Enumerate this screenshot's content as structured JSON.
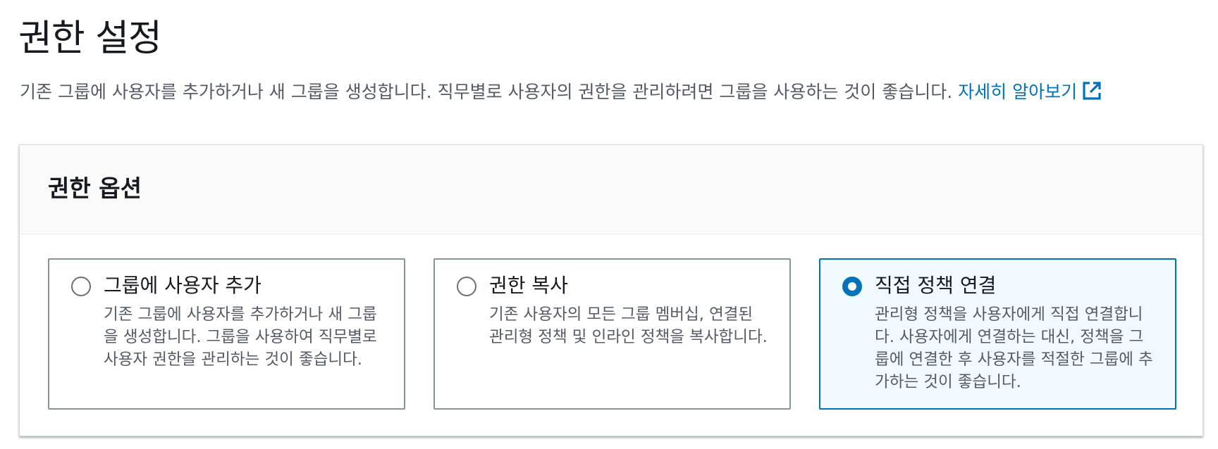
{
  "header": {
    "title": "권한 설정",
    "description": "기존 그룹에 사용자를 추가하거나 새 그룹을 생성합니다. 직무별로 사용자의 권한을 관리하려면 그룹을 사용하는 것이 좋습니다.",
    "learn_more": "자세히 알아보기",
    "learn_more_icon": "external-link-icon"
  },
  "panel": {
    "title": "권한 옵션",
    "options": [
      {
        "label": "그룹에 사용자 추가",
        "selected": false,
        "description_lines": [
          "기존 그룹에 사용자를 추가하거나 새 그룹",
          "을 생성합니다. 그룹을 사용하여 직무별로",
          "사용자 권한을 관리하는 것이 좋습니다."
        ]
      },
      {
        "label": "권한 복사",
        "selected": false,
        "description_lines": [
          "기존 사용자의 모든 그룹 멤버십, 연결된",
          "관리형 정책 및 인라인 정책을 복사합니다."
        ]
      },
      {
        "label": "직접 정책 연결",
        "selected": true,
        "description_lines": [
          "관리형 정책을 사용자에게 직접 연결합니",
          "다. 사용자에게 연결하는 대신, 정책을 그",
          "룹에 연결한 후 사용자를 적절한 그룹에 추",
          "가하는 것이 좋습니다."
        ]
      }
    ]
  },
  "colors": {
    "accent": "#0073bb",
    "text": "#16191f",
    "muted_text": "#545b64",
    "selected_bg": "#f1faff",
    "border": "#879596"
  }
}
